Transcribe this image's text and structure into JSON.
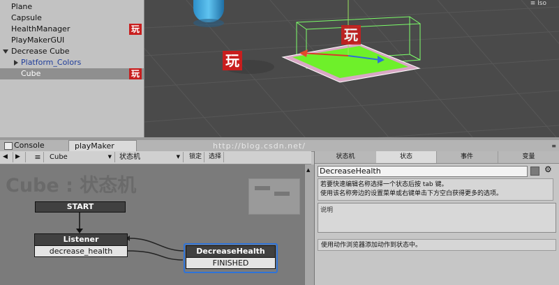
{
  "hierarchy": {
    "items": [
      {
        "label": "Plane"
      },
      {
        "label": "Capsule"
      },
      {
        "label": "HealthManager",
        "badge": "玩"
      },
      {
        "label": "PlayMakerGUI"
      },
      {
        "label": "Decrease Cube"
      },
      {
        "label": "Platform_Colors"
      },
      {
        "label": "Cube",
        "badge": "玩"
      }
    ]
  },
  "scene": {
    "view_label": "≡ Iso",
    "badges": [
      "玩",
      "玩"
    ]
  },
  "tabs": {
    "console": "Console",
    "playmaker": "playMaker"
  },
  "watermark": "http://blog.csdn.net/",
  "toolbar": {
    "object": "Cube",
    "fsm": "状态机",
    "lock": "锁定",
    "select": "选择"
  },
  "graph": {
    "title": "Cube : 状态机",
    "start_label": "START",
    "states": [
      {
        "name": "Listener",
        "event": "decrease_health"
      },
      {
        "name": "DecreaseHealth",
        "event": "FINISHED"
      }
    ]
  },
  "inspector": {
    "tabs": [
      "状态机",
      "状态",
      "事件",
      "变量"
    ],
    "active_tab": "状态",
    "state_name": "DecreaseHealth",
    "hint_line1": "若要快速编辑名称选择一个状态后按 tab 键。",
    "hint_line2": "使用该名称旁边的设置菜单或右键单击下方空白获得更多的选项。",
    "description_placeholder": "说明",
    "action_hint": "使用动作浏览器添加动作到状态中。"
  },
  "colors": {
    "selected_state_border": "#2e73d8",
    "badge_red": "#c81e1e",
    "platform_green": "#6ef02a"
  }
}
